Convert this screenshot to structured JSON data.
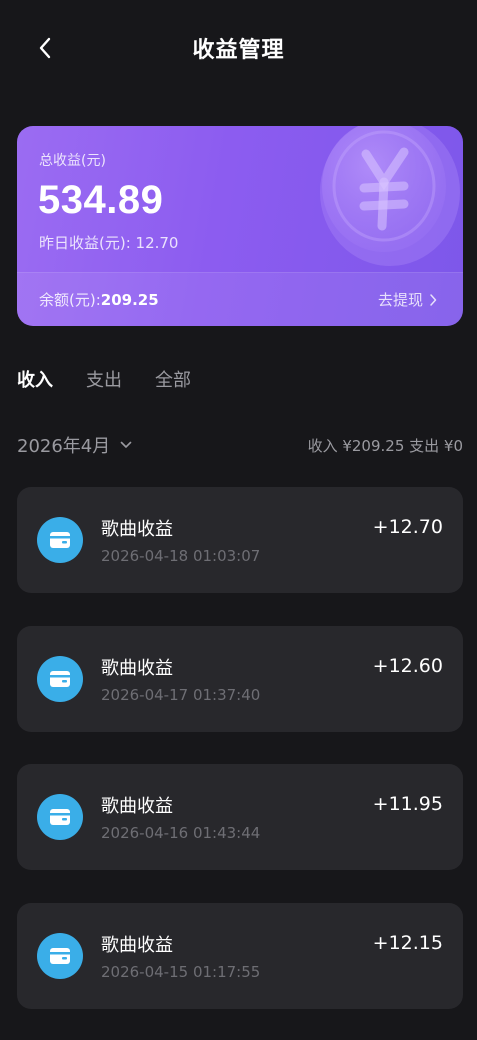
{
  "header": {
    "title": "收益管理"
  },
  "card": {
    "total_label": "总收益(元)",
    "total_amount": "534.89",
    "yesterday_text": "昨日收益(元): 12.70",
    "balance_label": "余额(元):",
    "balance_value": "209.25",
    "withdraw_label": "去提现"
  },
  "tabs": [
    {
      "label": "收入",
      "active": true
    },
    {
      "label": "支出",
      "active": false
    },
    {
      "label": "全部",
      "active": false
    }
  ],
  "filter": {
    "month": "2026年4月",
    "summary": "收入 ¥209.25 支出 ¥0"
  },
  "records": [
    {
      "title": "歌曲收益",
      "time": "2026-04-18 01:03:07",
      "amount": "+12.70",
      "icon": "wallet-icon"
    },
    {
      "title": "歌曲收益",
      "time": "2026-04-17 01:37:40",
      "amount": "+12.60",
      "icon": "wallet-icon"
    },
    {
      "title": "歌曲收益",
      "time": "2026-04-16 01:43:44",
      "amount": "+11.95",
      "icon": "wallet-icon"
    },
    {
      "title": "歌曲收益",
      "time": "2026-04-15 01:17:55",
      "amount": "+12.15",
      "icon": "wallet-icon"
    }
  ],
  "colors": {
    "background": "#17171a",
    "card_gradient_start": "#9b6cf2",
    "card_gradient_end": "#7d57ea",
    "record_bg": "#28282c",
    "wallet_icon_bg": "#3aaee8"
  }
}
